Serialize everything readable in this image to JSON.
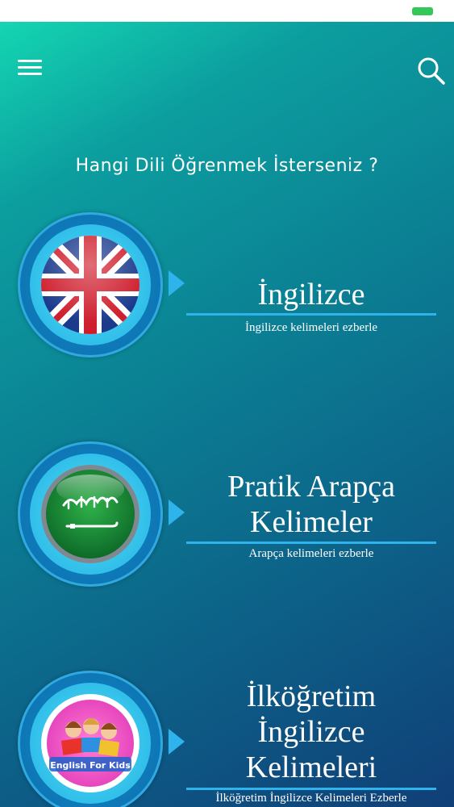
{
  "header": {
    "question": "Hangi Dili Öğrenmek İsterseniz ?"
  },
  "icons": {
    "menu": "menu-icon",
    "search": "search-icon",
    "battery": "battery-icon"
  },
  "colors": {
    "accent": "#2fb3ec",
    "battery": "#34c759",
    "text": "#ffffff"
  },
  "languages": [
    {
      "title_lines": [
        "İngilizce"
      ],
      "subtitle": "İngilizce kelimeleri ezberle",
      "flag": "uk-flag"
    },
    {
      "title_lines": [
        "Pratik Arapça",
        "Kelimeler"
      ],
      "subtitle": "Arapça kelimeleri ezberle",
      "flag": "saudi-flag"
    },
    {
      "title_lines": [
        "İlköğretim",
        "İngilizce",
        "Kelimeleri"
      ],
      "subtitle": "İlköğretim İngilizce Kelimeleri Ezberle",
      "flag": "english-for-kids-logo",
      "logo_text": "English For Kids"
    }
  ]
}
